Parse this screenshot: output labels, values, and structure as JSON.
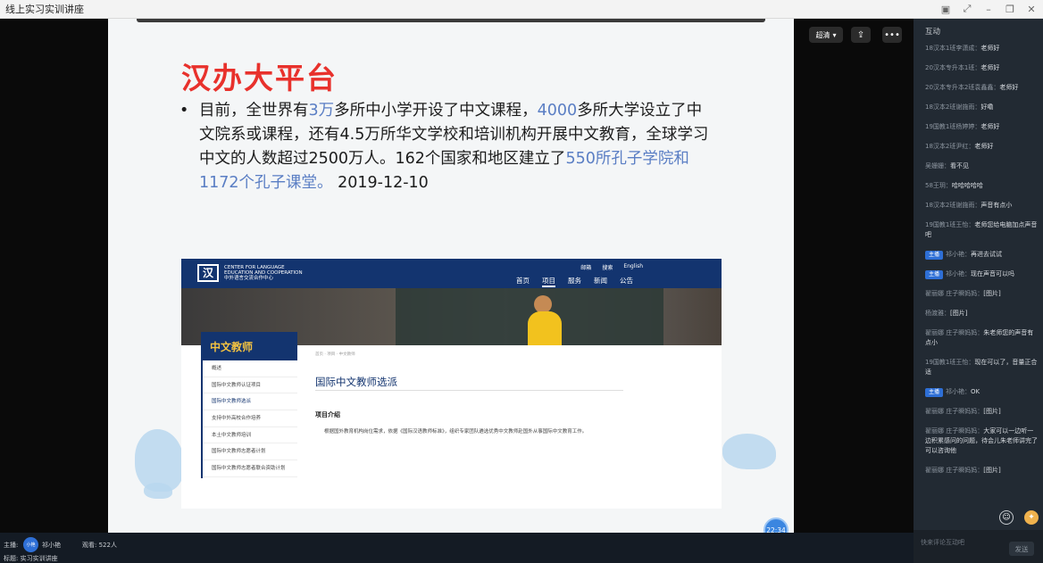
{
  "window": {
    "title": "线上实习实训讲座",
    "controls": [
      "▣",
      "⤢",
      "–",
      "❐",
      "✕"
    ]
  },
  "slide": {
    "title": "汉办大平台",
    "bullet": {
      "p1": "目前，全世界有",
      "h1": "3万",
      "p2": "多所中小学开设了中文课程，",
      "h2": "4000",
      "p3": "多所大学设立了中文院系或课程，还有4.5万所华文学校和培训机构开展中文教育，全球学习中文的人数超过2500万人。162个国家和地区建立了",
      "h3": "550所孔子学院和1172个孔子课堂。",
      "p4": " 2019-12-10"
    },
    "website": {
      "logo": "汉",
      "org_line1": "CENTER FOR LANGUAGE",
      "org_line2": "EDUCATION AND COOPERATION",
      "org_line3": "中外语言交流合作中心",
      "top_links": [
        "邮箱",
        "搜索",
        "English"
      ],
      "menu": [
        "首页",
        "项目",
        "服务",
        "新闻",
        "公告"
      ],
      "menu_active": "项目",
      "sidebar_title": "中文教师",
      "sidebar_items": [
        "概述",
        "国际中文教师认证项目",
        "国际中文教师选派",
        "支持中外高校合作培养",
        "本土中文教师培训",
        "国际中文教师志愿者计划",
        "国际中文教师志愿者联合资助计划"
      ],
      "sidebar_active_index": 2,
      "breadcrumb": "首页 · 项目 · 中文教师",
      "heading": "国际中文教师选派",
      "subheading": "项目介绍",
      "paragraph": "根据国外教育机构岗位需求，依据《国际汉语教师标准》，组织专家团队遴选优秀中文教师赴国外从事国际中文教育工作。"
    }
  },
  "overlay": {
    "clarity_label": "超清",
    "share_icon": "share-icon",
    "more_icon": "more-icon",
    "timer": "22:34"
  },
  "chat": {
    "title": "互动",
    "messages": [
      {
        "badge": "",
        "name": "18汉本1班李潇成：",
        "text": "老师好"
      },
      {
        "badge": "",
        "name": "20汉本专升本1班：",
        "text": "老师好"
      },
      {
        "badge": "",
        "name": "20汉本专升本2班袁鑫鑫：",
        "text": "老师好"
      },
      {
        "badge": "",
        "name": "18汉本2班谢施雨：",
        "text": "好嘞"
      },
      {
        "badge": "",
        "name": "19国教1班杨婷婷：",
        "text": "老师好"
      },
      {
        "badge": "",
        "name": "18汉本2班尹红：",
        "text": "老师好"
      },
      {
        "badge": "",
        "name": "吴姗姗：",
        "text": "看不见"
      },
      {
        "badge": "",
        "name": "58王玥：",
        "text": "哈哈哈哈哈"
      },
      {
        "badge": "",
        "name": "18汉本2班谢施雨：",
        "text": "声音有点小"
      },
      {
        "badge": "",
        "name": "19国教1班王怡：",
        "text": "老师您给电脑加点声音吧"
      },
      {
        "badge": "主播",
        "name": "祁小艳：",
        "text": "再进去试试"
      },
      {
        "badge": "主播",
        "name": "祁小艳：",
        "text": "现在声音可以吗"
      },
      {
        "badge": "",
        "name": "翟丽娜 庄子瞬妈妈：",
        "text": "[图片]"
      },
      {
        "badge": "",
        "name": "杨渡雅：",
        "text": "[图片]"
      },
      {
        "badge": "",
        "name": "翟丽娜 庄子瞬妈妈：",
        "text": "朱老师您的声音有点小"
      },
      {
        "badge": "",
        "name": "19国教1班王怡：",
        "text": "现在可以了，音量正合适"
      },
      {
        "badge": "主播",
        "name": "祁小艳：",
        "text": "OK"
      },
      {
        "badge": "",
        "name": "翟丽娜 庄子瞬妈妈：",
        "text": "[图片]"
      },
      {
        "badge": "",
        "name": "翟丽娜 庄子瞬妈妈：",
        "text": "大家可以一边听一边积累感问的问题，待会儿朱老师讲完了可以咨询他"
      },
      {
        "badge": "",
        "name": "翟丽娜 庄子瞬妈妈：",
        "text": "[图片]"
      }
    ],
    "input_placeholder": "快来评论互动吧",
    "send_label": "发送"
  },
  "bottom": {
    "host_label": "主播:",
    "host_avatar_text": "小艳",
    "host_name": "祁小艳",
    "viewers": "观看: 522人",
    "topic": "标题: 实习实训讲座"
  }
}
